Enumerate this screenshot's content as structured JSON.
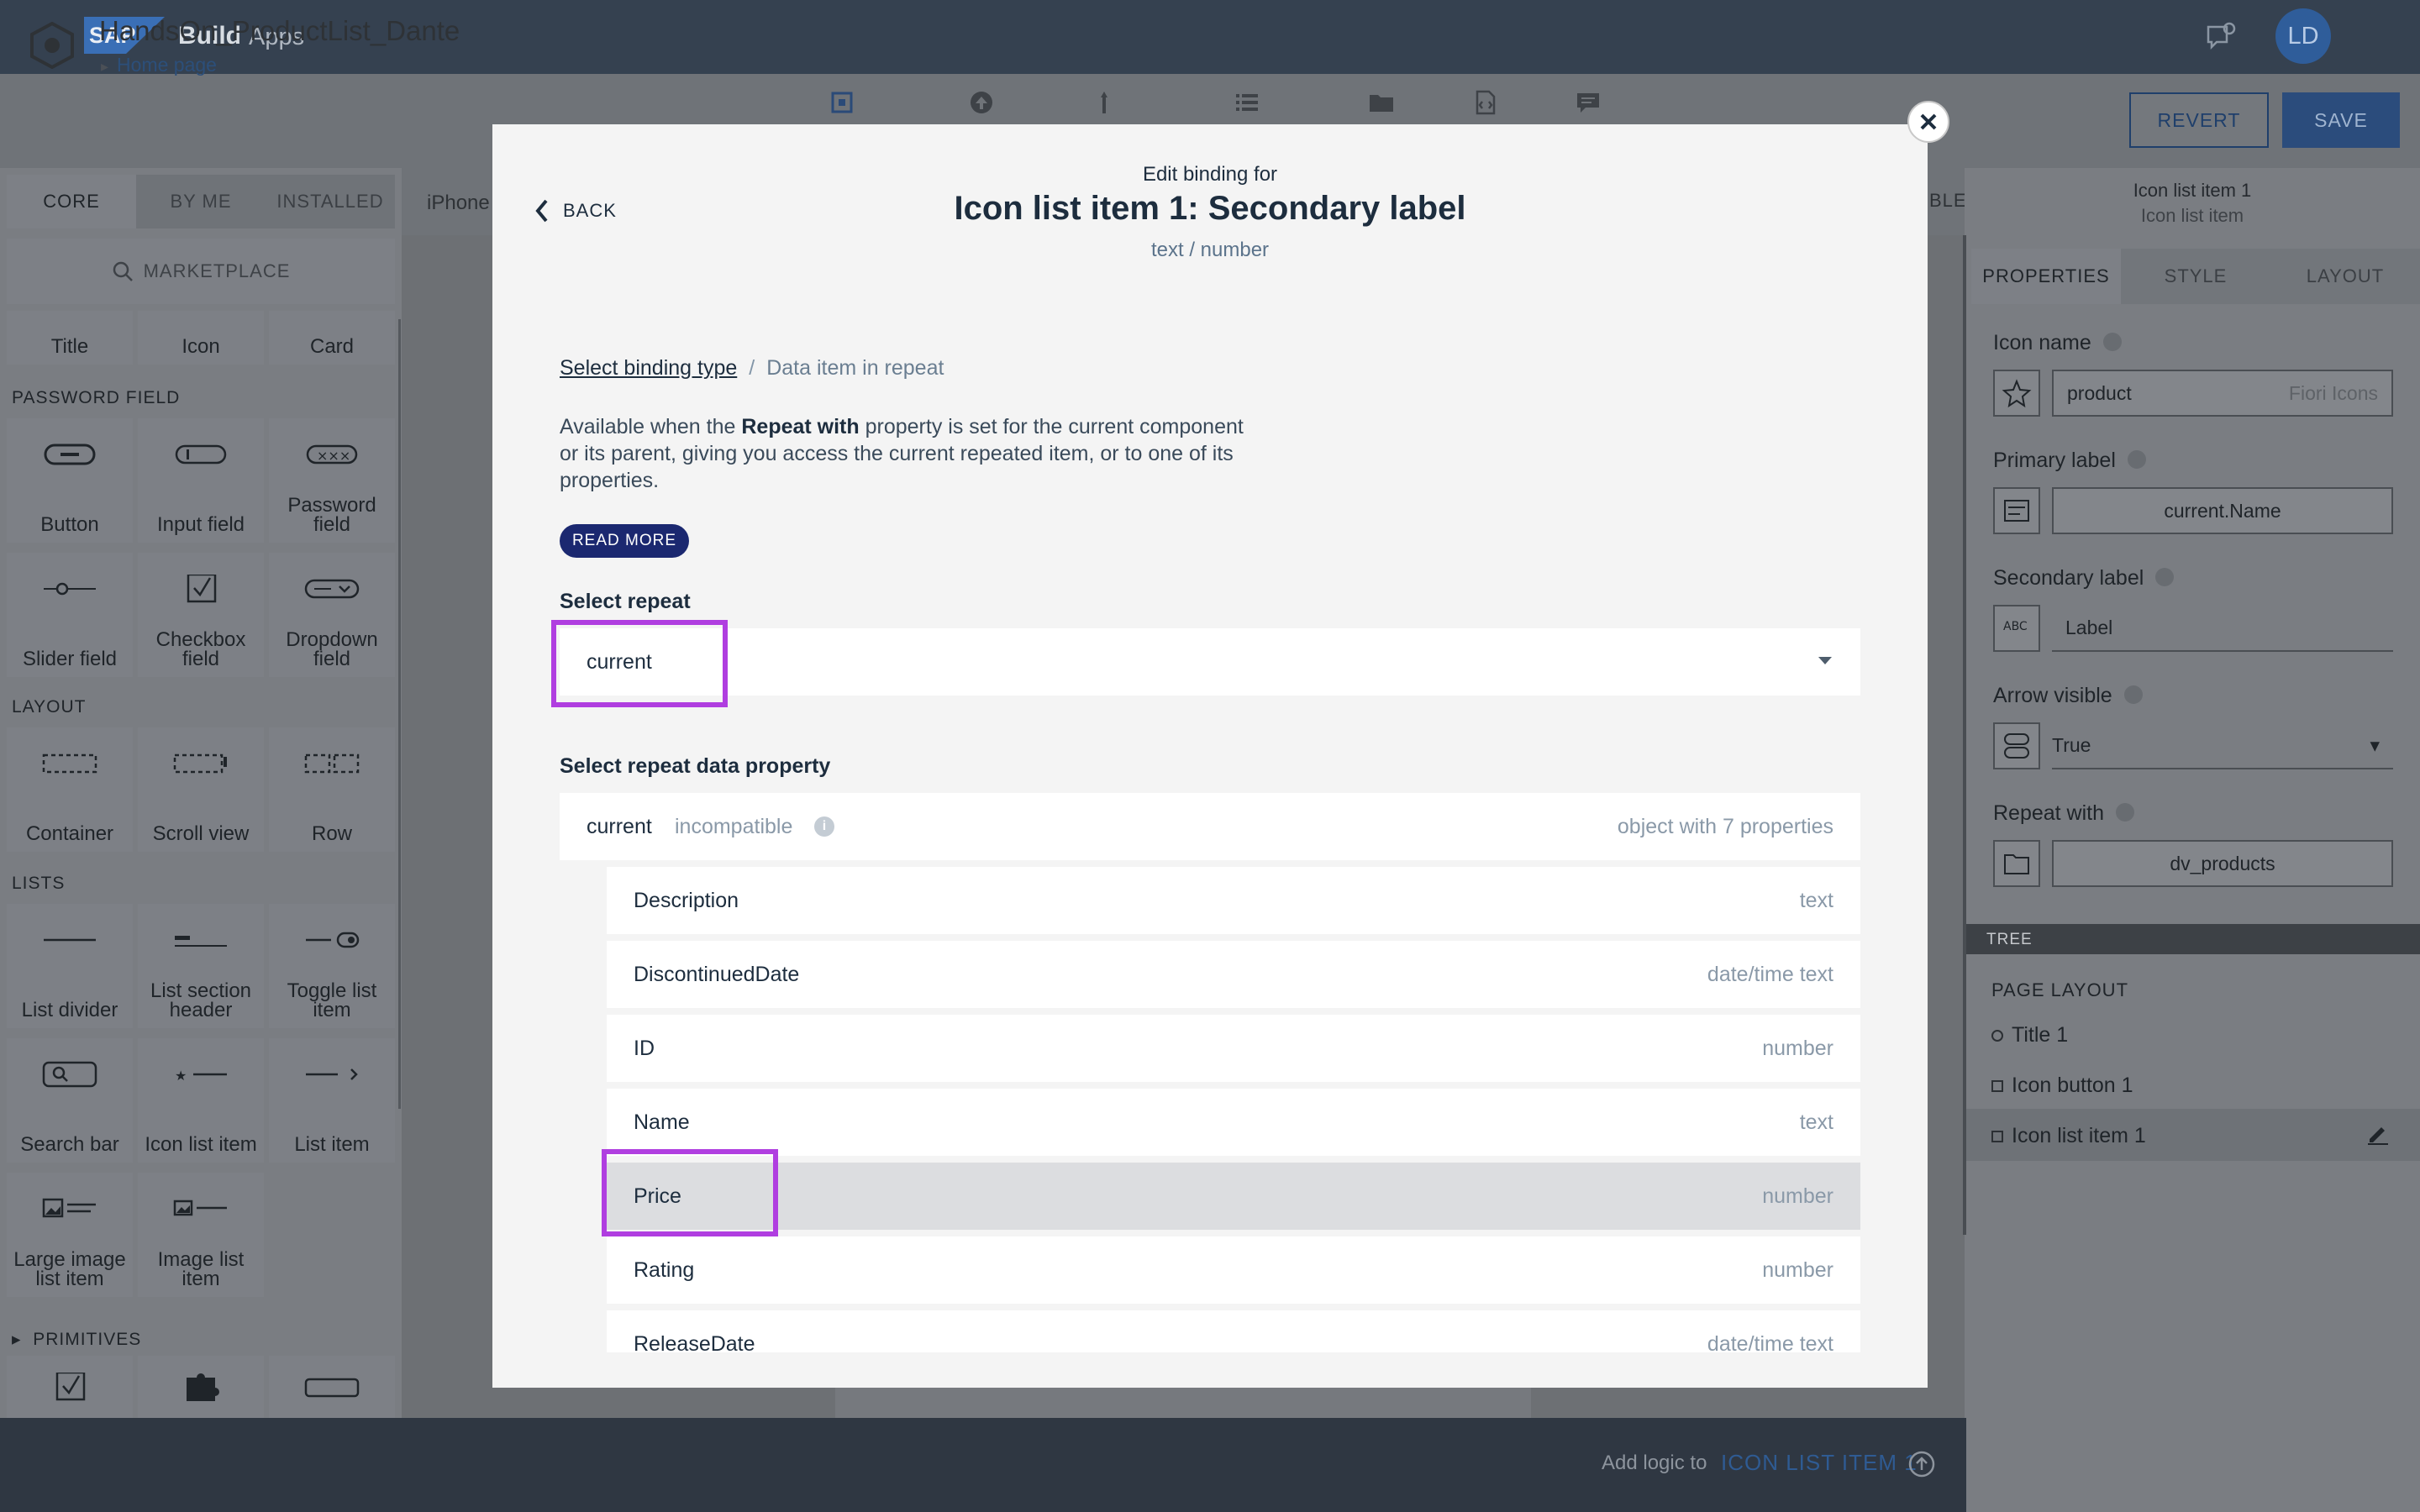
{
  "shell": {
    "logo": "SAP",
    "product_bold": "Build",
    "product": "Apps",
    "avatar_initials": "LD"
  },
  "project": {
    "name": "HandsOn_ProductList_Dante",
    "breadcrumb": "Home page",
    "revert_label": "REVERT",
    "save_label": "SAVE",
    "toolbar_icons": [
      "view-icon",
      "upload-icon",
      "pin-icon",
      "list-icon",
      "folder-icon",
      "code-icon",
      "chat-icon"
    ]
  },
  "left_panel": {
    "tabs": [
      "CORE",
      "BY ME",
      "INSTALLED"
    ],
    "marketplace": "MARKETPLACE",
    "basic_tiles": [
      "Title",
      "Icon",
      "Card"
    ],
    "sections": {
      "password_field": "PASSWORD FIELD",
      "layout": "LAYOUT",
      "lists": "LISTS",
      "primitives": "PRIMITIVES"
    },
    "form_tiles": [
      "Button",
      "Input field",
      "Password field",
      "Slider field",
      "Checkbox field",
      "Dropdown field"
    ],
    "layout_tiles": [
      "Container",
      "Scroll view",
      "Row"
    ],
    "list_tiles": [
      "List divider",
      "List section header",
      "Toggle list item",
      "Search bar",
      "Icon list item",
      "List item",
      "Large image list item",
      "Image list item"
    ]
  },
  "canvas": {
    "device_label": "iPhone",
    "variables_tab_partial": "BLES"
  },
  "right_panel": {
    "component_title": "Icon list item 1",
    "component_type": "Icon list item",
    "tabs": [
      "PROPERTIES",
      "STYLE",
      "LAYOUT"
    ],
    "props": {
      "icon_name_label": "Icon name",
      "icon_name_value": "product",
      "icon_name_hint": "Fiori Icons",
      "primary_label_label": "Primary label",
      "primary_label_value": "current.Name",
      "secondary_label_label": "Secondary label",
      "secondary_label_value": "Label",
      "arrow_visible_label": "Arrow visible",
      "arrow_visible_value": "True",
      "repeat_with_label": "Repeat with",
      "repeat_with_value": "dv_products"
    },
    "tree_label": "TREE",
    "page_layout_label": "PAGE LAYOUT",
    "tree_items": [
      "Title 1",
      "Icon button 1",
      "Icon list item 1"
    ]
  },
  "bottom_bar": {
    "add_logic_text": "Add logic to",
    "add_logic_target": "ICON LIST ITEM 1"
  },
  "modal": {
    "back_label": "BACK",
    "subtitle": "Edit binding for",
    "title": "Icon list item 1: Secondary label",
    "type_hint": "text / number",
    "breadcrumb_link": "Select binding type",
    "breadcrumb_sep": "/",
    "breadcrumb_current": "Data item in repeat",
    "desc_before": "Available when the ",
    "desc_bold": "Repeat with",
    "desc_after": " property is set for the current component or its parent, giving you access the current repeated item, or to one of its properties.",
    "read_more": "READ MORE",
    "select_repeat_label": "Select repeat",
    "select_repeat_value": "current",
    "select_property_label": "Select repeat data property",
    "parent": {
      "name": "current",
      "status": "incompatible",
      "type": "object with 7 properties"
    },
    "properties": [
      {
        "name": "Description",
        "type": "text"
      },
      {
        "name": "DiscontinuedDate",
        "type": "date/time text"
      },
      {
        "name": "ID",
        "type": "number"
      },
      {
        "name": "Name",
        "type": "text"
      },
      {
        "name": "Price",
        "type": "number"
      },
      {
        "name": "Rating",
        "type": "number"
      },
      {
        "name": "ReleaseDate",
        "type": "date/time text"
      }
    ],
    "selected_property": "Price",
    "highlight_color": "#b03ee0"
  }
}
